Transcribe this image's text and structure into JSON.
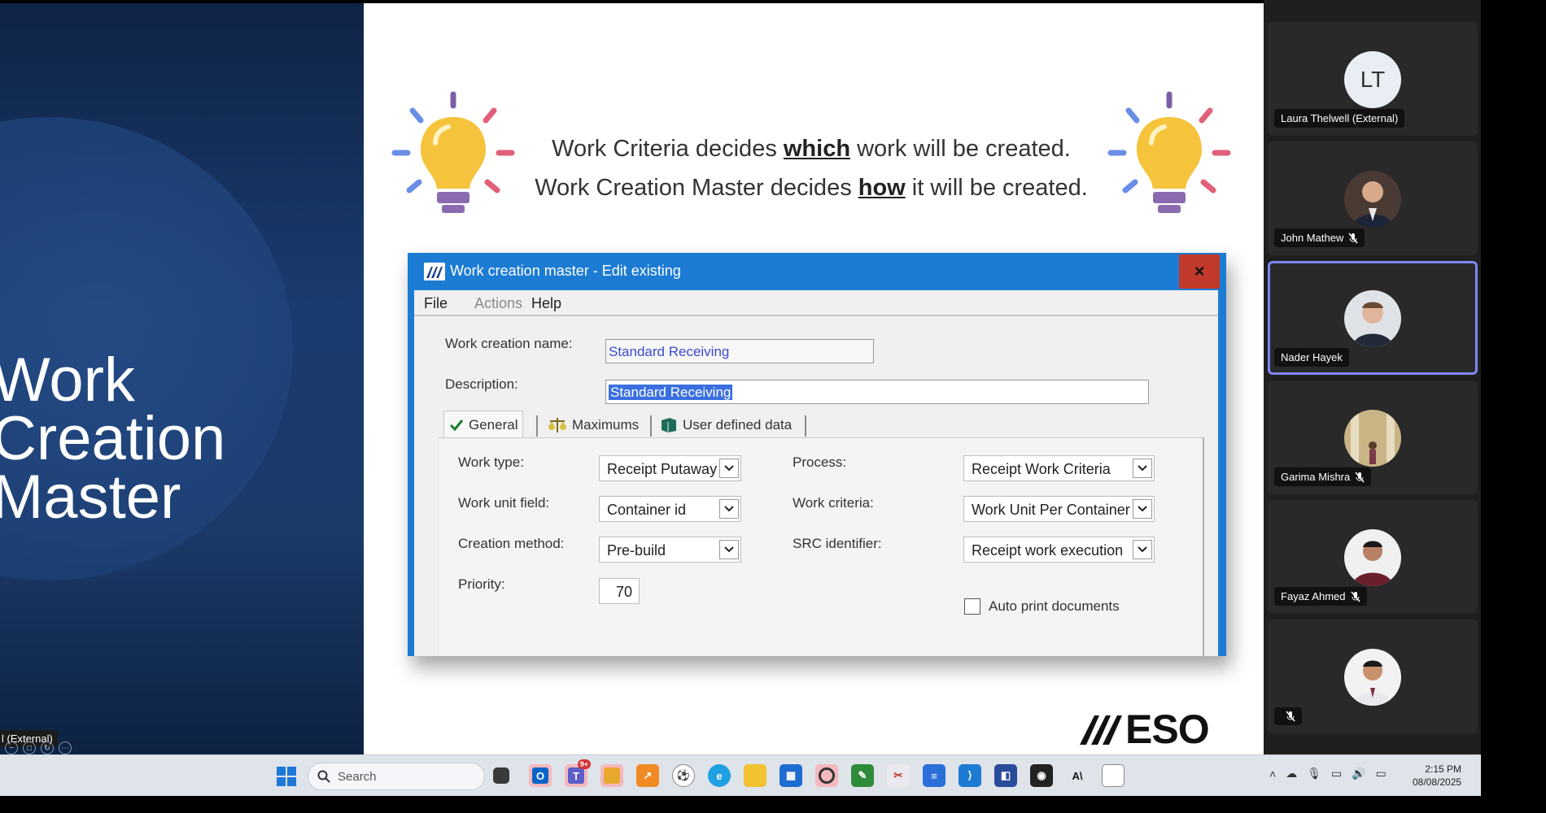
{
  "left_slide": {
    "title": "Work\nCreation\nMaster",
    "participant_label": "l (External)"
  },
  "slide": {
    "tagline_line1_pre": "Work Criteria decides ",
    "tagline_line1_u": "which",
    "tagline_line1_post": " work will be created.",
    "tagline_line2_pre": "Work Creation Master decides ",
    "tagline_line2_u": "how",
    "tagline_line2_post": " it will be created.",
    "logo_text": "ESO"
  },
  "dialog": {
    "title": "Work creation master - Edit existing",
    "close_label": "×",
    "menu": {
      "file": "File",
      "actions": "Actions",
      "help": "Help"
    },
    "fields": {
      "work_creation_name_label": "Work creation name:",
      "work_creation_name_value": "Standard Receiving",
      "description_label": "Description:",
      "description_value": "Standard Receiving"
    },
    "tabs": [
      {
        "label": "General",
        "icon": "check-icon"
      },
      {
        "label": "Maximums",
        "icon": "scales-icon"
      },
      {
        "label": "User defined data",
        "icon": "book-icon"
      }
    ],
    "general": {
      "work_type_label": "Work type:",
      "work_type_value": "Receipt Putaway",
      "work_unit_field_label": "Work unit field:",
      "work_unit_field_value": "Container id",
      "creation_method_label": "Creation method:",
      "creation_method_value": "Pre-build",
      "priority_label": "Priority:",
      "priority_value": "70",
      "process_label": "Process:",
      "process_value": "Receipt Work Criteria",
      "work_criteria_label": "Work criteria:",
      "work_criteria_value": "Work Unit Per Container",
      "src_identifier_label": "SRC identifier:",
      "src_identifier_value": "Receipt work execution",
      "auto_print_label": "Auto print documents"
    }
  },
  "gallery": {
    "participants": [
      {
        "name": "Laura Thelwell (External)",
        "initials": "LT",
        "muted": false
      },
      {
        "name": "John Mathew",
        "muted": true
      },
      {
        "name": "Nader Hayek",
        "muted": false,
        "active": true
      },
      {
        "name": "Garima Mishra",
        "muted": true
      },
      {
        "name": "Fayaz Ahmed",
        "muted": true
      },
      {
        "name": "",
        "muted": true
      }
    ]
  },
  "taskbar": {
    "search_placeholder": "Search",
    "teams_badge": "9+",
    "clock_time": "2:15 PM",
    "clock_date": "08/08/2025"
  },
  "colors": {
    "dialog_blue": "#1c7bd3",
    "close_red": "#c0392b",
    "active_tile_border": "#7f85f5"
  }
}
